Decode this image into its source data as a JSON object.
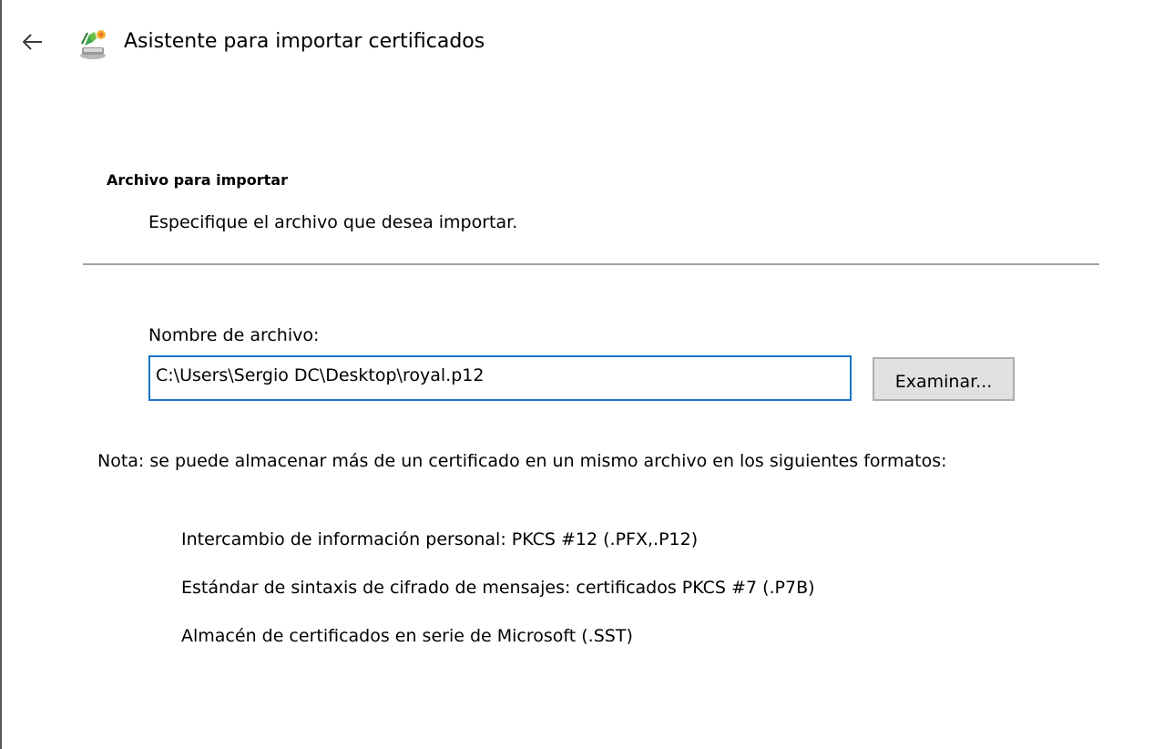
{
  "window": {
    "title": "Asistente para importar certificados",
    "back_icon": "arrow-left-icon",
    "title_icon": "certificate-wizard-icon"
  },
  "page": {
    "heading": "Archivo para importar",
    "subheading": "Especifique el archivo que desea importar."
  },
  "file": {
    "label": "Nombre de archivo:",
    "value": "C:\\Users\\Sergio DC\\Desktop\\royal.p12",
    "browse_label": "Examinar..."
  },
  "note": {
    "text": "Nota: se puede almacenar más de un certificado en un mismo archivo en los siguientes formatos:",
    "formats": [
      "Intercambio de información personal: PKCS #12 (.PFX,.P12)",
      "Estándar de sintaxis de cifrado de mensajes: certificados PKCS #7 (.P7B)",
      "Almacén de certificados en serie de Microsoft (.SST)"
    ]
  },
  "colors": {
    "input_border": "#1a75c9",
    "button_background": "#e1e1e1",
    "divider": "#a0a0a0"
  }
}
